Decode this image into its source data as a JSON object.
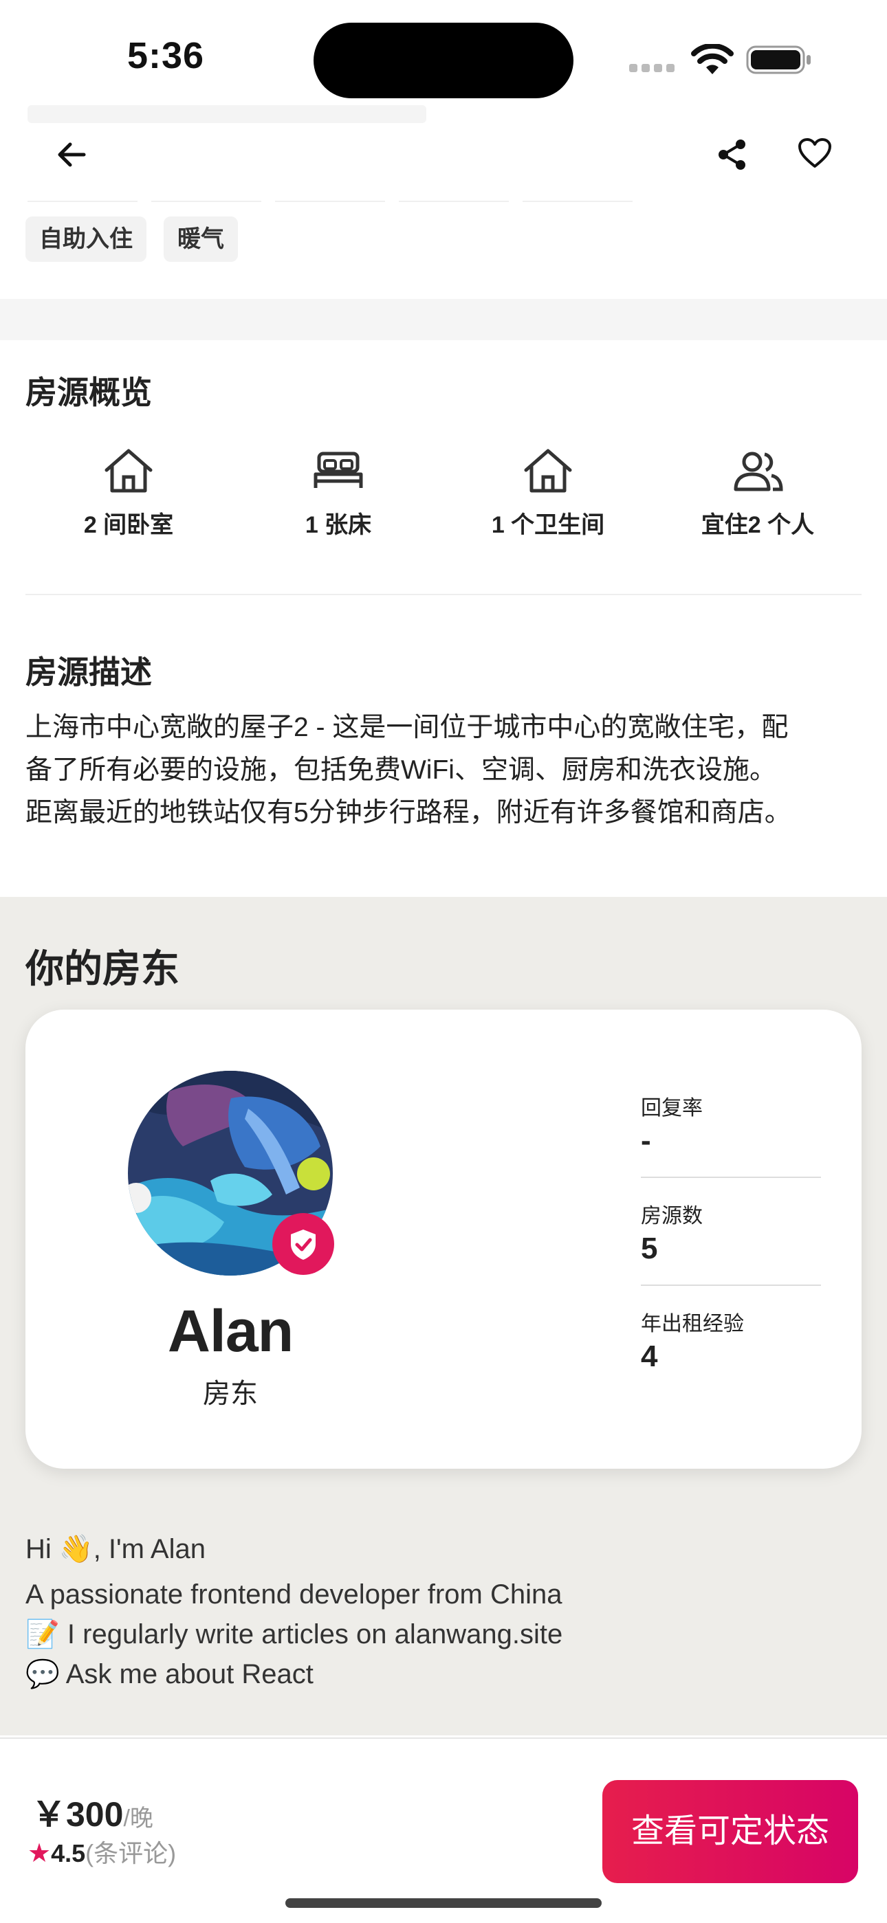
{
  "status_bar": {
    "time": "5:36"
  },
  "nav": {
    "back_icon": "arrow-left-icon",
    "share_icon": "share-icon",
    "favorite_icon": "heart-icon"
  },
  "tags": [
    "自助入住",
    "暖气"
  ],
  "overview": {
    "title": "房源概览",
    "items": [
      {
        "icon": "house-icon",
        "label": "2 间卧室"
      },
      {
        "icon": "bed-icon",
        "label": "1 张床"
      },
      {
        "icon": "house-icon",
        "label": "1 个卫生间"
      },
      {
        "icon": "people-icon",
        "label": "宜住2 个人"
      }
    ]
  },
  "description": {
    "title": "房源描述",
    "lines": [
      "上海市中心宽敞的屋子2 - 这是一间位于城市中心的宽敞住宅，配",
      "备了所有必要的设施，包括免费WiFi、空调、厨房和洗衣设施。",
      "距离最近的地铁站仅有5分钟步行路程，附近有许多餐馆和商店。"
    ]
  },
  "host": {
    "title": "你的房东",
    "name": "Alan",
    "role": "房东",
    "stats": [
      {
        "label": "回复率",
        "value": "-"
      },
      {
        "label": "房源数",
        "value": "5"
      },
      {
        "label": "年出租经验",
        "value": "4"
      }
    ],
    "bio": [
      "Hi 👋, I'm Alan",
      "A passionate frontend developer from China",
      "📝 I regularly write articles on alanwang.site",
      "💬 Ask me about React"
    ]
  },
  "booking": {
    "currency": "￥",
    "price": "300",
    "per": "/晚",
    "rating": "4.5",
    "review_text": "(条评论)",
    "cta": "查看可定状态"
  },
  "colors": {
    "accent": "#e1185c",
    "host_bg": "#eeede9"
  }
}
